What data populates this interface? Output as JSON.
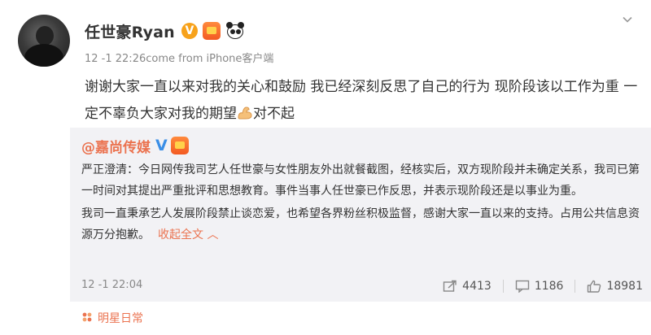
{
  "post": {
    "author": "任世豪Ryan",
    "verified_badge": "V",
    "meta": "12 -1 22:26come from iPhone客户端",
    "text_part1": "谢谢大家一直以来对我的关心和鼓励 我已经深刻反思了自己的行为 现阶段该以工作为重 一定不辜负大家对我的期望",
    "text_part2": "对不起",
    "icons": [
      "vip-badge-icon",
      "panda-icon",
      "flexed-biceps-emoji",
      "chevron-down-icon"
    ]
  },
  "repost": {
    "author": "@嘉尚传媒",
    "verified_badge": "V",
    "paragraph1": "严正澄清：今日网传我司艺人任世豪与女性朋友外出就餐截图，经核实后，双方现阶段并未确定关系，我司已第一时间对其提出严重批评和思想教育。事件当事人任世豪已作反思，并表示现阶段还是以事业为重。",
    "paragraph2": "我司一直秉承艺人发展阶段禁止谈恋爱，也希望各界粉丝积极监督，感谢大家一直以来的支持。占用公共信息资源万分抱歉。",
    "collapse_label": "收起全文 ︿",
    "time": "12 -1 22:04",
    "stats": {
      "reposts": "4413",
      "comments": "1186",
      "likes": "18981"
    }
  },
  "topic": {
    "label": "明星日常"
  },
  "colors": {
    "accent_orange": "#eb7350",
    "verified_gold": "#f7a21b",
    "verified_blue": "#3a8ee6",
    "repost_bg": "#f2f2f5",
    "muted_text": "#888888"
  }
}
